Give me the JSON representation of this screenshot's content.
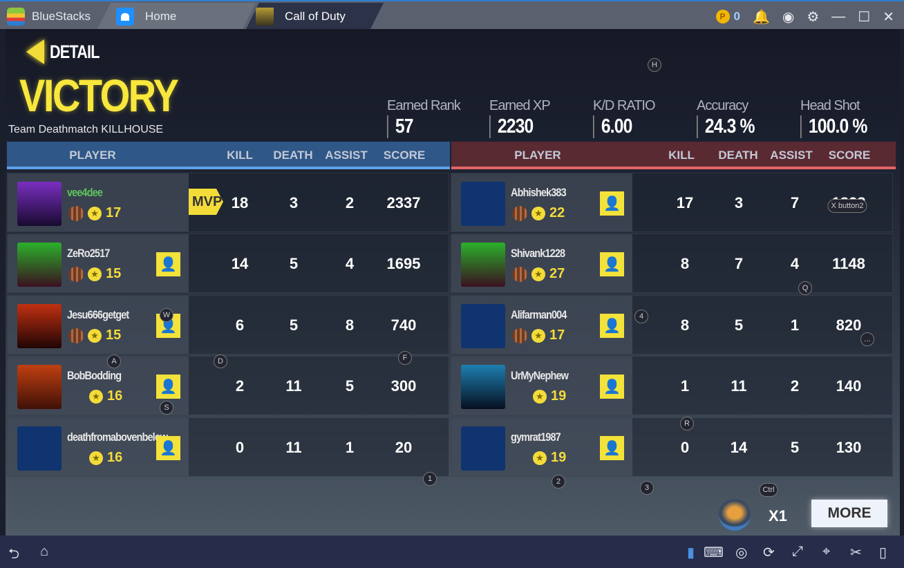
{
  "titlebar": {
    "app": "BlueStacks",
    "tabs": [
      {
        "label": "Home"
      },
      {
        "label": "Call of Duty"
      }
    ],
    "coins": "0"
  },
  "header": {
    "back_label": "DETAIL",
    "result": "VICTORY",
    "mode": "Team Deathmatch KILLHOUSE"
  },
  "stats": [
    {
      "label": "Earned Rank",
      "value": "57"
    },
    {
      "label": "Earned XP",
      "value": "2230"
    },
    {
      "label": "K/D RATIO",
      "value": "6.00"
    },
    {
      "label": "Accuracy",
      "value": "24.3 %"
    },
    {
      "label": "Head Shot",
      "value": "100.0 %"
    }
  ],
  "columns": {
    "player": "PLAYER",
    "kill": "KILL",
    "death": "DEATH",
    "assist": "ASSIST",
    "score": "SCORE"
  },
  "mvp_label": "MVP",
  "colors": {
    "blue_team": "#2f5787",
    "red_team": "#5a2a33",
    "accent": "#f3dc3a",
    "self_name": "#5ec25e"
  },
  "blue_team": [
    {
      "name": "vee4dee",
      "medal": true,
      "level": "17",
      "kill": "18",
      "death": "3",
      "assist": "2",
      "score": "2337",
      "mvp": true,
      "self": true,
      "avatar": "goggles"
    },
    {
      "name": "ZeRo2517",
      "medal": true,
      "level": "15",
      "kill": "14",
      "death": "5",
      "assist": "4",
      "score": "1695",
      "avatar": "robot"
    },
    {
      "name": "Jesu666getget",
      "medal": true,
      "level": "15",
      "kill": "6",
      "death": "5",
      "assist": "8",
      "score": "740",
      "avatar": "demon"
    },
    {
      "name": "BobBodding",
      "medal": false,
      "level": "16",
      "kill": "2",
      "death": "11",
      "assist": "5",
      "score": "300",
      "avatar": "fist"
    },
    {
      "name": "deathfromabovenbelow",
      "medal": false,
      "level": "16",
      "kill": "0",
      "death": "11",
      "assist": "1",
      "score": "20",
      "avatar": "eagle"
    }
  ],
  "red_team": [
    {
      "name": "Abhishek383",
      "medal": true,
      "level": "22",
      "kill": "17",
      "death": "3",
      "assist": "7",
      "score": "1828",
      "avatar": "eagle"
    },
    {
      "name": "Shivank1228",
      "medal": true,
      "level": "27",
      "kill": "8",
      "death": "7",
      "assist": "4",
      "score": "1148",
      "avatar": "robot"
    },
    {
      "name": "Alifarman004",
      "medal": true,
      "level": "17",
      "kill": "8",
      "death": "5",
      "assist": "1",
      "score": "820",
      "avatar": "eagle"
    },
    {
      "name": "UrMyNephew",
      "medal": false,
      "level": "19",
      "kill": "1",
      "death": "11",
      "assist": "2",
      "score": "140",
      "avatar": "shark"
    },
    {
      "name": "gymrat1987",
      "medal": false,
      "level": "19",
      "kill": "0",
      "death": "14",
      "assist": "5",
      "score": "130",
      "avatar": "eagle"
    }
  ],
  "footer": {
    "multiplier": "X1",
    "more_label": "MORE"
  },
  "key_hints": [
    "H",
    "W",
    "A",
    "S",
    "D",
    "F",
    "Q",
    "R",
    "1",
    "2",
    "3",
    "4",
    "Ctrl",
    "X button2",
    "..."
  ]
}
